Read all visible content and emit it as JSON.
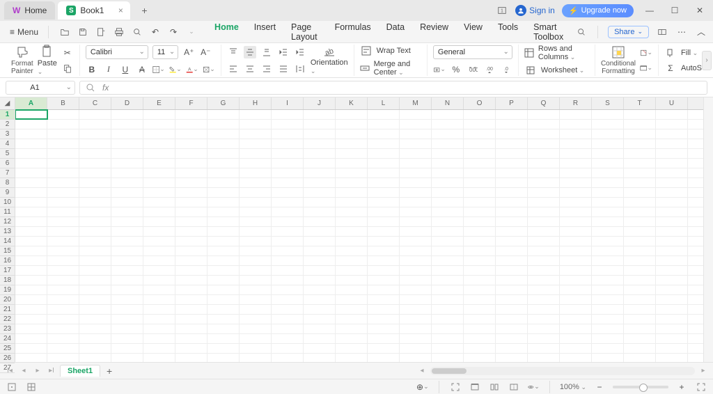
{
  "titlebar": {
    "home_tab": "Home",
    "doc_tab": "Book1",
    "signin": "Sign in",
    "upgrade": "Upgrade now"
  },
  "menubar": {
    "menu": "Menu",
    "tabs": [
      "Home",
      "Insert",
      "Page Layout",
      "Formulas",
      "Data",
      "Review",
      "View",
      "Tools",
      "Smart Toolbox"
    ],
    "active_tab": 0,
    "share": "Share"
  },
  "ribbon": {
    "format_painter": "Format\nPainter",
    "paste": "Paste",
    "font_name": "Calibri",
    "font_size": "11",
    "wrap_text": "Wrap Text",
    "merge_center": "Merge and Center",
    "orientation": "Orientation",
    "number_format": "General",
    "rows_cols": "Rows and Columns",
    "worksheet": "Worksheet",
    "cond_fmt": "Conditional\nFormatting",
    "fill": "Fill",
    "autosum": "AutoSum"
  },
  "formula_bar": {
    "namebox": "A1"
  },
  "grid": {
    "columns": [
      "A",
      "B",
      "C",
      "D",
      "E",
      "F",
      "G",
      "H",
      "I",
      "J",
      "K",
      "L",
      "M",
      "N",
      "O",
      "P",
      "Q",
      "R",
      "S",
      "T",
      "U"
    ],
    "row_count": 27,
    "selected_row": 1,
    "selected_col": 0
  },
  "sheets": {
    "active": "Sheet1"
  },
  "status": {
    "zoom": "100%"
  }
}
